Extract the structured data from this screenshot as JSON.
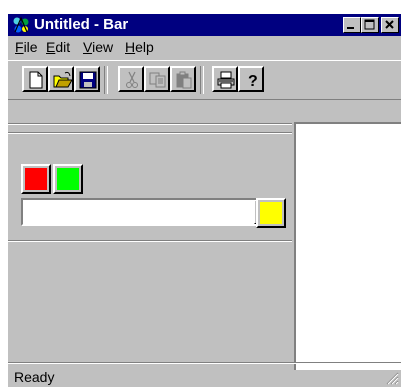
{
  "window": {
    "title": "Untitled - Bar"
  },
  "menu": {
    "items": [
      {
        "label": "File",
        "hotkey_char": "F"
      },
      {
        "label": "Edit",
        "hotkey_char": "E"
      },
      {
        "label": "View",
        "hotkey_char": "V"
      },
      {
        "label": "Help",
        "hotkey_char": "H"
      }
    ]
  },
  "toolbar": {
    "buttons": [
      {
        "name": "new-file",
        "icon": "new-document-icon",
        "enabled": true
      },
      {
        "name": "open-file",
        "icon": "open-folder-icon",
        "enabled": true
      },
      {
        "name": "save-file",
        "icon": "floppy-disk-icon",
        "enabled": true
      },
      {
        "name": "cut",
        "icon": "scissors-icon",
        "enabled": false
      },
      {
        "name": "copy",
        "icon": "copy-icon",
        "enabled": false
      },
      {
        "name": "paste",
        "icon": "paste-icon",
        "enabled": false
      },
      {
        "name": "print",
        "icon": "printer-icon",
        "enabled": true
      },
      {
        "name": "help",
        "icon": "help-question-icon",
        "enabled": true
      }
    ]
  },
  "colors": {
    "red": "#ff0000",
    "green": "#00ff00",
    "yellow": "#ffff00",
    "title_bg": "#000080",
    "face": "#c0c0c0"
  },
  "combo": {
    "value": ""
  },
  "status": {
    "text": "Ready"
  }
}
